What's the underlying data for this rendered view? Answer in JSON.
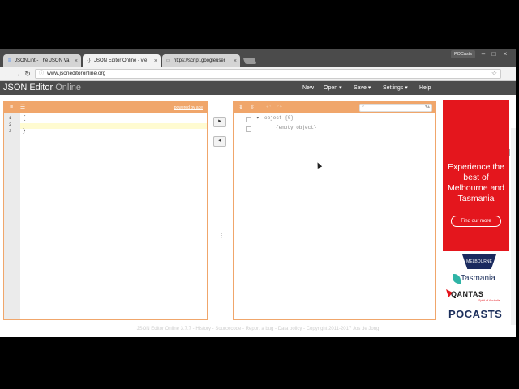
{
  "browser": {
    "tabs": [
      {
        "label": "JSONLint - The JSON Va",
        "icon": "jsonlint-favicon"
      },
      {
        "label": "JSON Editor Online - vie",
        "icon": "braces-favicon"
      },
      {
        "label": "https://script.googleuser",
        "icon": "page-favicon"
      }
    ],
    "profile": "POCasts",
    "url": "www.jsoneditoronline.org"
  },
  "app": {
    "title_main": "JSON Editor",
    "title_sub": "Online",
    "menu": {
      "new": "New",
      "open": "Open ▾",
      "save": "Save ▾",
      "settings": "Settings ▾",
      "help": "Help"
    }
  },
  "code_editor": {
    "powered_by": "powered by ace",
    "line_numbers": [
      "1",
      "2",
      "3"
    ],
    "lines": [
      "{",
      "",
      "}"
    ]
  },
  "tree_editor": {
    "root": "object {0}",
    "empty": "{empty object}"
  },
  "ad": {
    "headline": "Experience the best of Melbourne and Tasmania",
    "cta": "Find our more",
    "logo_melbourne": "MELBOURNE",
    "logo_tasmania": "Tasmania",
    "logo_qantas": "QANTAS",
    "qantas_tagline": "Spirit of Australia",
    "logo_pocasts": "POCASTS"
  },
  "footer": "JSON Editor Online 3.7.7 - History - Sourcecode - Report a bug - Data policy - Copyright 2011-2017 Jos de Jong",
  "colors": {
    "accent": "#f0a66b",
    "header": "#4c4c4c",
    "ad_red": "#e4161d"
  }
}
